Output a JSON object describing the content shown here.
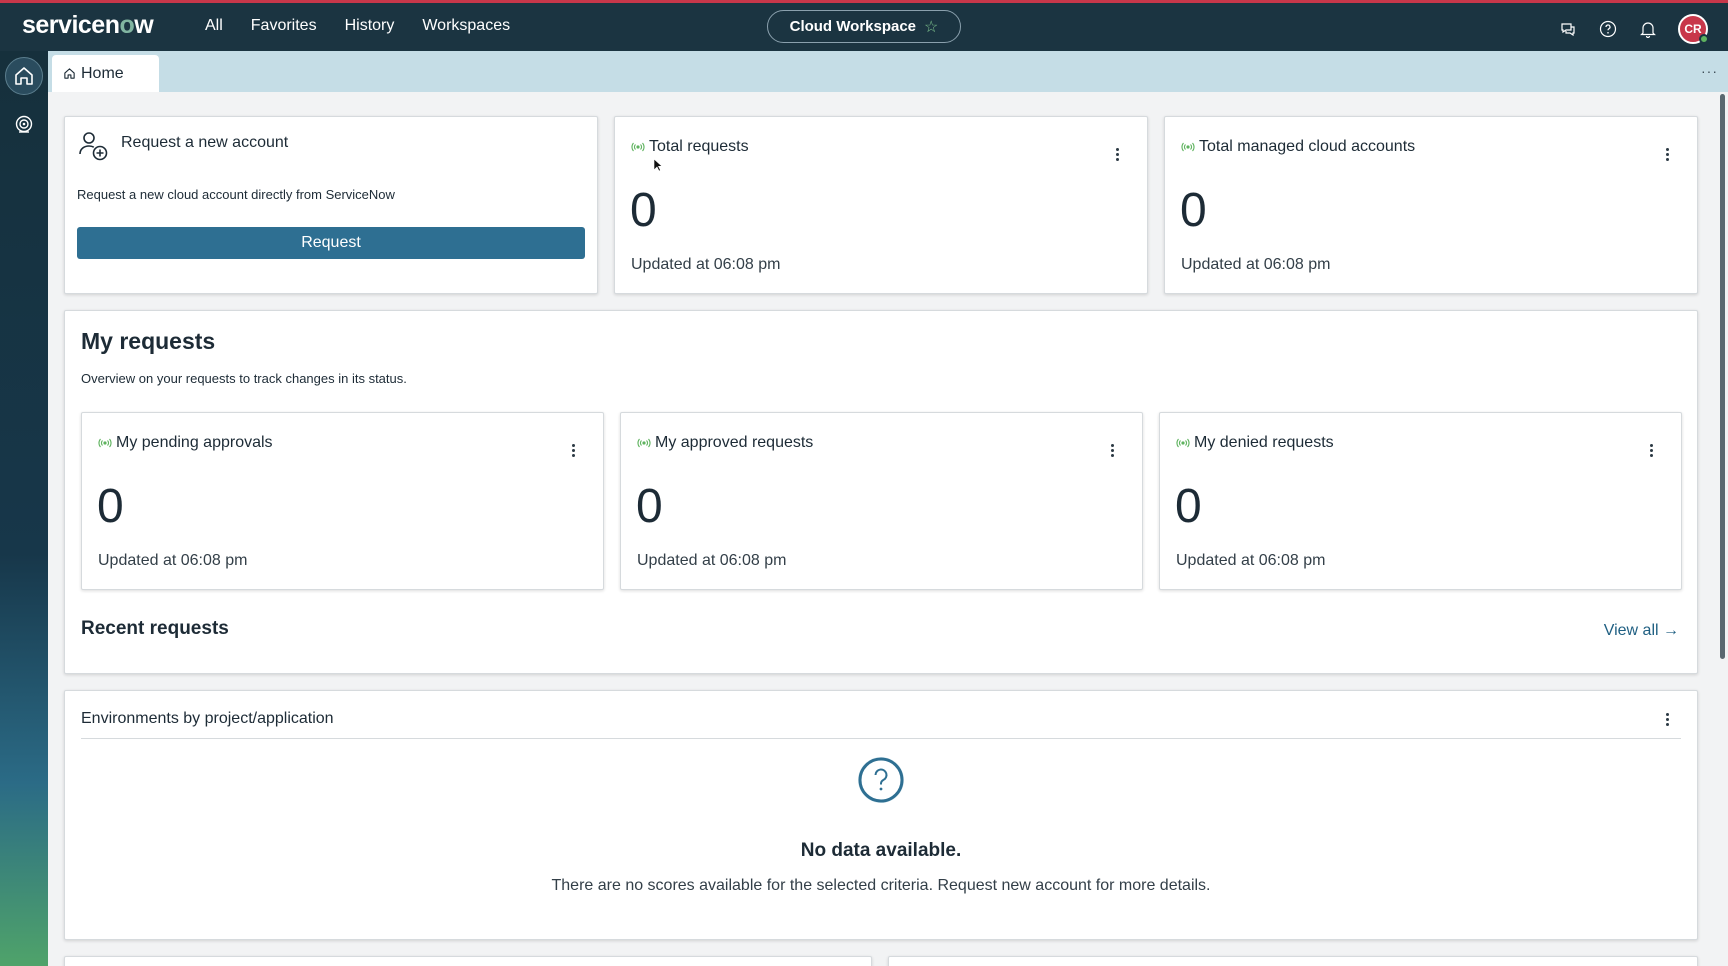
{
  "topnav": {
    "logo_prefix": "servicen",
    "logo_o": "o",
    "logo_suffix": "w",
    "menu": [
      "All",
      "Favorites",
      "History",
      "Workspaces"
    ],
    "workspace": "Cloud Workspace",
    "avatar_initials": "CR"
  },
  "tabs": {
    "home": "Home"
  },
  "request_card": {
    "title": "Request a new account",
    "description": "Request a new cloud account directly from ServiceNow",
    "button": "Request"
  },
  "metrics": [
    {
      "title": "Total requests",
      "value": "0",
      "updated": "Updated at 06:08 pm"
    },
    {
      "title": "Total managed cloud accounts",
      "value": "0",
      "updated": "Updated at 06:08 pm"
    }
  ],
  "my_requests": {
    "title": "My requests",
    "description": "Overview on your requests to track changes in its status.",
    "cards": [
      {
        "title": "My pending approvals",
        "value": "0",
        "updated": "Updated at 06:08 pm"
      },
      {
        "title": "My approved requests",
        "value": "0",
        "updated": "Updated at 06:08 pm"
      },
      {
        "title": "My denied requests",
        "value": "0",
        "updated": "Updated at 06:08 pm"
      }
    ],
    "recent_title": "Recent requests",
    "view_all": "View all"
  },
  "environments": {
    "title": "Environments by project/application",
    "empty_title": "No data available.",
    "empty_desc": "There are no scores available for the selected criteria. Request new account for more details."
  },
  "colors": {
    "topbar": "#1b3441",
    "accent_bar": "#c8374a",
    "primary_button": "#2e6f92",
    "live_indicator": "#5fb35f",
    "tab_bar": "#c5dde6"
  }
}
